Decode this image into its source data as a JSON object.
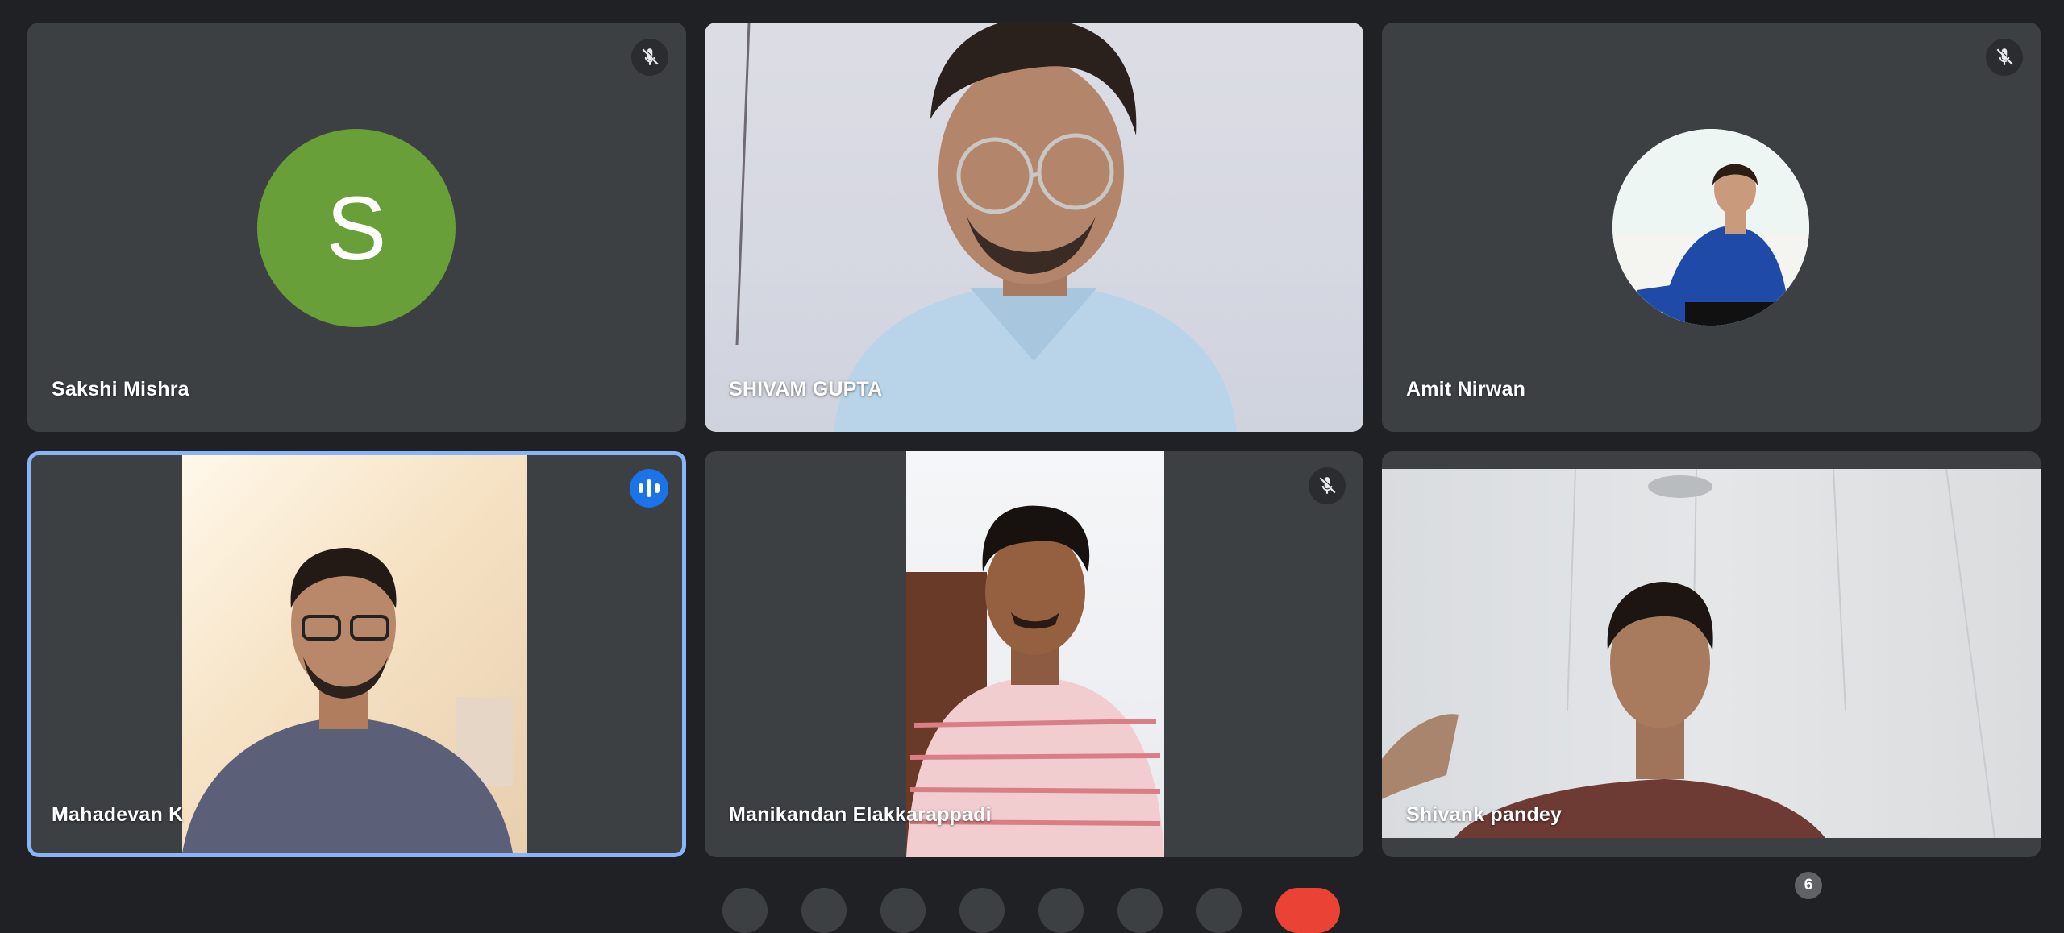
{
  "participants": [
    {
      "name": "Sakshi Mishra",
      "initial": "S",
      "muted": true,
      "avatar_color": "#689f38"
    },
    {
      "name": "SHIVAM GUPTA",
      "muted": false
    },
    {
      "name": "Amit Nirwan",
      "muted": true
    },
    {
      "name": "Mahadevan K",
      "muted": false,
      "speaking": true
    },
    {
      "name": "Manikandan Elakkarappadi",
      "muted": true
    },
    {
      "name": "Shivank pandey",
      "muted": false
    }
  ],
  "people_count": "6",
  "colors": {
    "background": "#202124",
    "tile": "#3c4043",
    "active_border": "#8ab4f8",
    "speaking_badge": "#1a73e8",
    "end_call": "#ea4335"
  },
  "icons": {
    "muted": "mic-off-icon",
    "speaking": "audio-level-icon"
  }
}
